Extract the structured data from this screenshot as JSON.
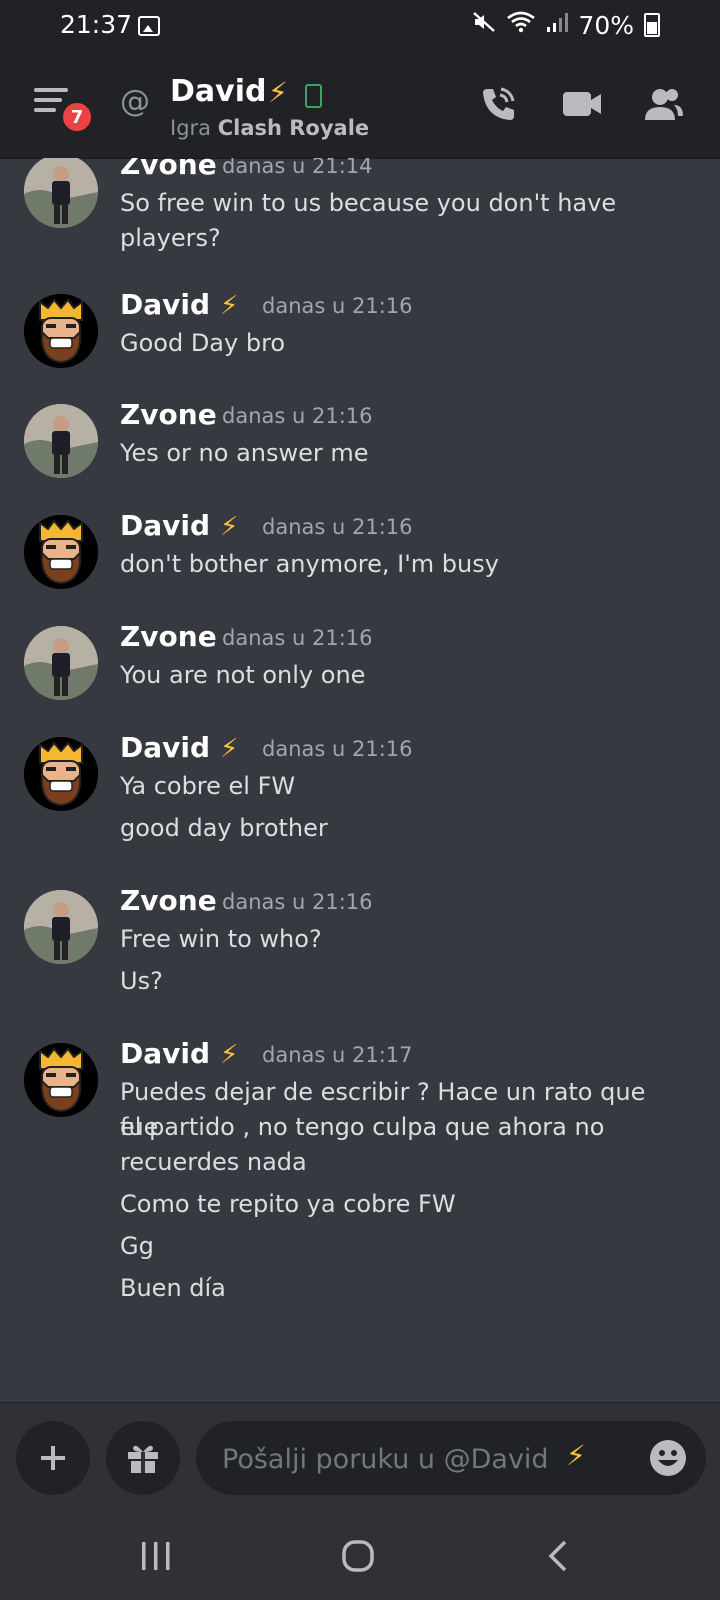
{
  "status_bar": {
    "time": "21:37",
    "battery": "70%"
  },
  "header": {
    "unread_count": "7",
    "at_symbol": "@",
    "name": "David",
    "bolt": "⚡",
    "activity_prefix": "Igra",
    "activity_game": "Clash Royale"
  },
  "messages": [
    {
      "author": "Zvone",
      "avatar": "zvone",
      "bolt": "",
      "timestamp": "danas u 21:14",
      "lines": [
        "So free win to us because you don't have",
        "players?"
      ]
    },
    {
      "author": "David",
      "avatar": "david",
      "bolt": "⚡",
      "timestamp": "danas u 21:16",
      "lines": [
        "Good Day bro"
      ]
    },
    {
      "author": "Zvone",
      "avatar": "zvone",
      "bolt": "",
      "timestamp": "danas u 21:16",
      "lines": [
        "Yes or no answer me"
      ]
    },
    {
      "author": "David",
      "avatar": "david",
      "bolt": "⚡",
      "timestamp": "danas u 21:16",
      "lines": [
        "don't bother anymore, I'm busy"
      ]
    },
    {
      "author": "Zvone",
      "avatar": "zvone",
      "bolt": "",
      "timestamp": "danas u 21:16",
      "lines": [
        "You are not only one"
      ]
    },
    {
      "author": "David",
      "avatar": "david",
      "bolt": "⚡",
      "timestamp": "danas u 21:16",
      "lines": [
        "Ya cobre el FW",
        "good day brother"
      ]
    },
    {
      "author": "Zvone",
      "avatar": "zvone",
      "bolt": "",
      "timestamp": "danas u 21:16",
      "lines": [
        "Free win to who?",
        "Us?"
      ]
    },
    {
      "author": "David",
      "avatar": "david",
      "bolt": "⚡",
      "timestamp": "danas u 21:17",
      "lines": [
        "Puedes dejar de escribir ? Hace un rato que fue",
        "el partido , no tengo culpa que ahora no",
        "recuerdes nada",
        "Como te repito ya cobre FW",
        "Gg",
        "Buen día"
      ]
    }
  ],
  "input": {
    "placeholder": "Pošalji poruku u @David",
    "bolt": "⚡"
  },
  "icons": {
    "call": "phone-call-icon",
    "video": "video-camera-icon",
    "members": "members-icon",
    "add": "plus-icon",
    "gift": "gift-icon",
    "emoji": "smiley-icon"
  },
  "colors": {
    "background": "#36393f",
    "header": "#202225",
    "badge": "#ed4245",
    "bolt": "#f8c23a",
    "mobile": "#3ba55d"
  }
}
